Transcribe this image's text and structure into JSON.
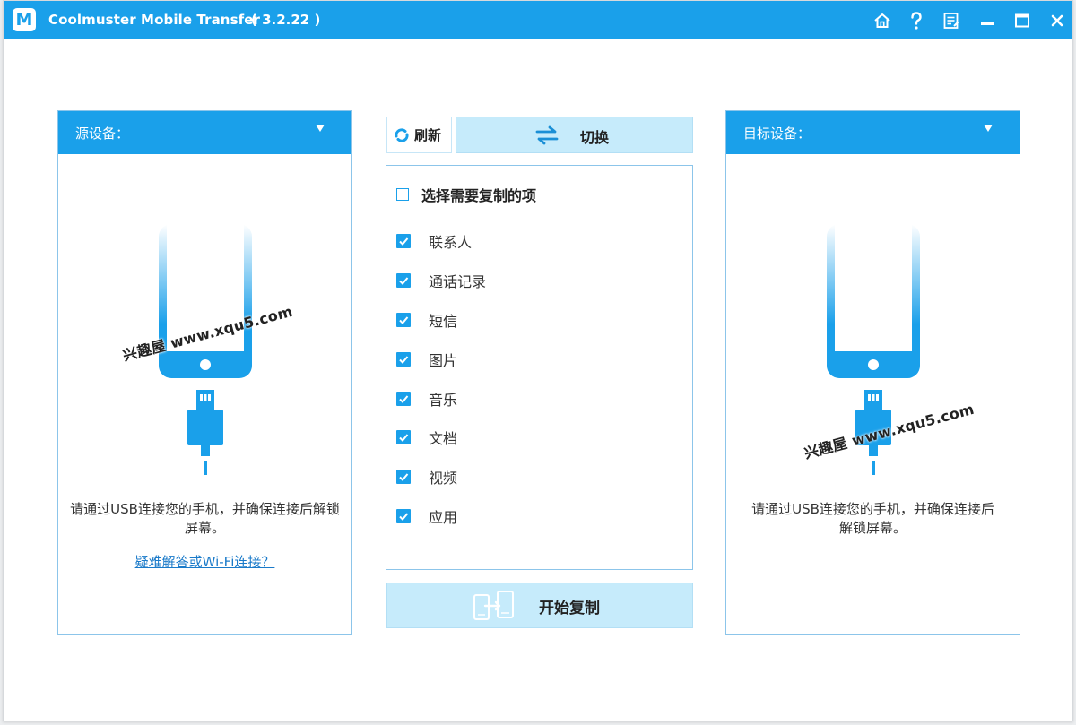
{
  "titlebar": {
    "app_title": "Coolmuster Mobile Transfer",
    "version": "( 3.2.22 )",
    "logo_letter": "M",
    "buttons": [
      "home-icon",
      "help-icon",
      "feedback-icon",
      "minimize-icon",
      "maximize-icon",
      "close-icon"
    ]
  },
  "source_panel": {
    "label": "源设备：",
    "message": "请通过USB连接您的手机，并确保连接后解锁屏幕。",
    "link": "疑难解答或Wi-Fi连接？"
  },
  "target_panel": {
    "label": "目标设备：",
    "message": "请通过USB连接您的手机，并确保连接后解锁屏幕。"
  },
  "toolbar": {
    "refresh_label": "刷新",
    "switch_label": "切换"
  },
  "items": {
    "select_all_label": "选择需要复制的项",
    "select_all_checked": false,
    "list": [
      {
        "label": "联系人",
        "checked": true
      },
      {
        "label": "通话记录",
        "checked": true
      },
      {
        "label": "短信",
        "checked": true
      },
      {
        "label": "图片",
        "checked": true
      },
      {
        "label": "音乐",
        "checked": true
      },
      {
        "label": "文档",
        "checked": true
      },
      {
        "label": "视频",
        "checked": true
      },
      {
        "label": "应用",
        "checked": true
      }
    ]
  },
  "start_button": {
    "label": "开始复制"
  },
  "watermarks": [
    "兴趣屋 www.xqu5.com",
    "兴趣屋 www.xqu5.com"
  ],
  "colors": {
    "accent": "#1aa0ea",
    "button_bg": "#c6ebfb",
    "link": "#1a7ac9"
  }
}
